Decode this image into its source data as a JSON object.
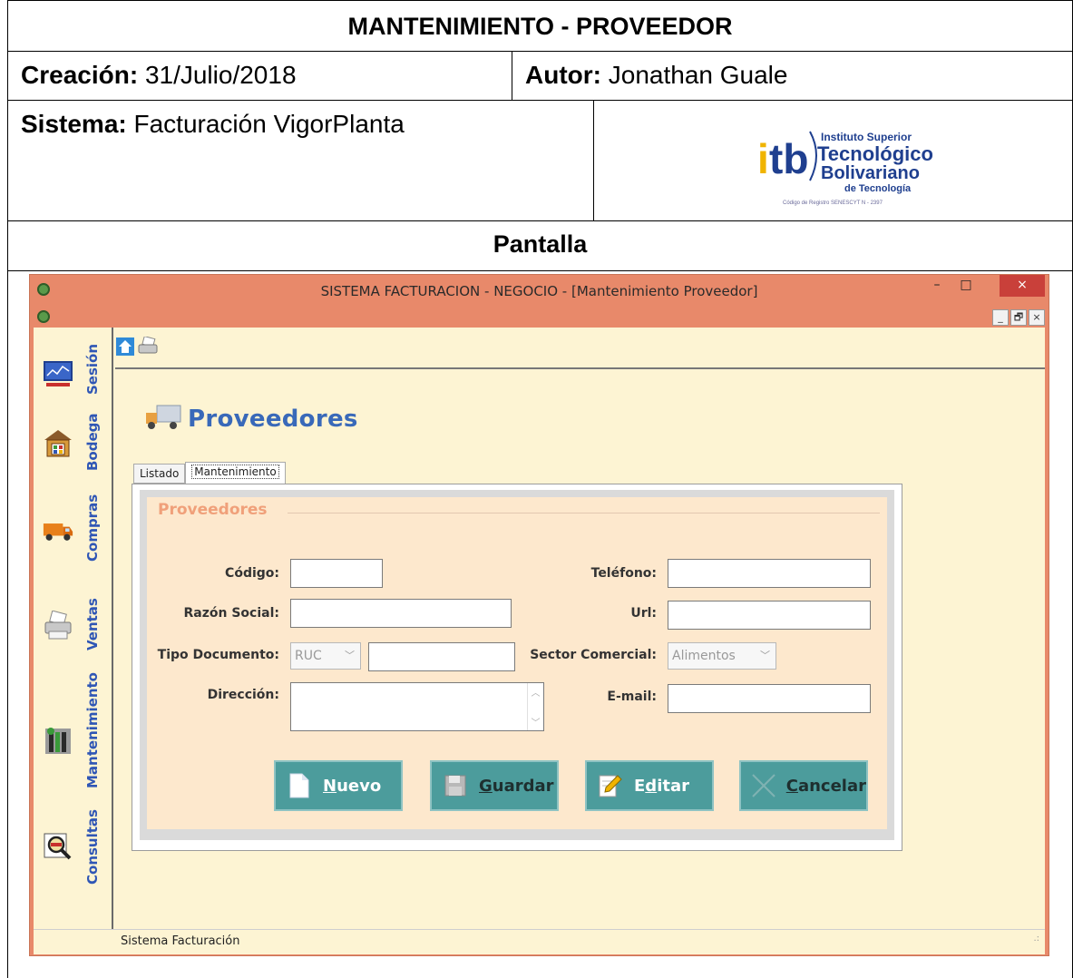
{
  "doc": {
    "title": "MANTENIMIENTO - PROVEEDOR",
    "creation_label": "Creación:",
    "creation_value": "31/Julio/2018",
    "author_label": "Autor:",
    "author_value": "Jonathan Guale",
    "system_label": "Sistema:",
    "system_value": "Facturación VigorPlanta",
    "screen_heading": "Pantalla",
    "logo": {
      "line1": "Instituto Superior",
      "line2": "Tecnológico",
      "line3": "Bolivariano",
      "line4": "de Tecnología",
      "line5": "Código de Registro SENESCYT N - 2397",
      "mark": "itb"
    }
  },
  "window": {
    "title": "SISTEMA FACTURACION - NEGOCIO - [Mantenimiento Proveedor]",
    "minimize": "–",
    "maximize": "□",
    "close": "×",
    "mdi_min": "_",
    "mdi_restore": "🗗",
    "mdi_close": "×"
  },
  "sidebar": {
    "items": [
      {
        "label": "Sesión",
        "icon": "monitor-chart-icon"
      },
      {
        "label": "Bodega",
        "icon": "warehouse-icon"
      },
      {
        "label": "Compras",
        "icon": "truck-icon"
      },
      {
        "label": "Ventas",
        "icon": "printer-icon"
      },
      {
        "label": "Mantenimiento",
        "icon": "tools-icon"
      },
      {
        "label": "Consultas",
        "icon": "magnifier-icon"
      }
    ]
  },
  "page": {
    "title": "Proveedores",
    "tabs": [
      "Listado",
      "Mantenimiento"
    ],
    "active_tab": "Mantenimiento"
  },
  "form": {
    "group_title": "Proveedores",
    "codigo_label": "Código:",
    "codigo_value": "",
    "razon_label": "Razón Social:",
    "razon_value": "",
    "tipo_doc_label": "Tipo Documento:",
    "tipo_doc_value": "RUC",
    "doc_number_value": "",
    "direccion_label": "Dirección:",
    "direccion_value": "",
    "telefono_label": "Teléfono:",
    "telefono_value": "",
    "url_label": "Url:",
    "url_value": "",
    "sector_label": "Sector Comercial:",
    "sector_value": "Alimentos",
    "email_label": "E-mail:",
    "email_value": ""
  },
  "buttons": {
    "nuevo": {
      "accel": "N",
      "rest": "uevo"
    },
    "guardar": {
      "accel": "G",
      "rest": "uardar"
    },
    "editar": {
      "pre": "E",
      "accel": "d",
      "rest": "itar"
    },
    "cancelar": {
      "accel": "C",
      "rest": "ancelar"
    }
  },
  "status": {
    "text": "Sistema Facturación"
  },
  "colors": {
    "titlebar": "#e8896a",
    "client_bg": "#fdf4d3",
    "groupbox_bg": "#fde8cd",
    "button_teal": "#4c9c9c",
    "label_blue": "#2f56b5",
    "close_red": "#c9403a"
  }
}
